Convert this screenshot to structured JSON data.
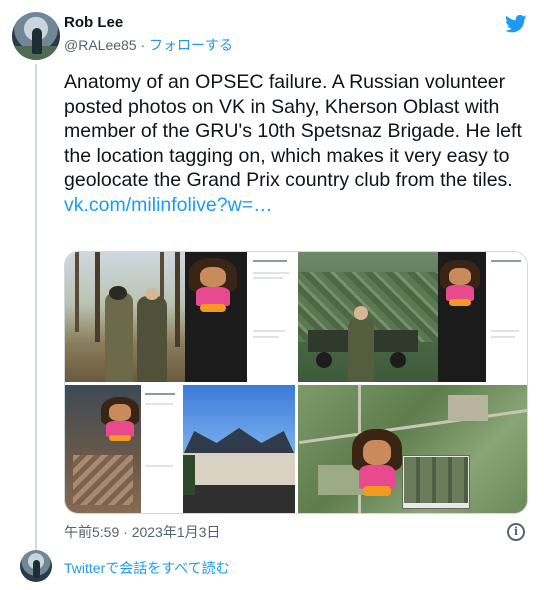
{
  "author": {
    "name": "Rob Lee",
    "handle": "@RALee85",
    "separator": "·",
    "follow_label": "フォローする"
  },
  "tweet": {
    "text": "Anatomy of an OPSEC failure. A Russian volunteer posted photos on VK in Sahy, Kherson Oblast with member of the GRU's 10th Spetsnaz Brigade. He left the location tagging on, which makes it very easy to geolocate the Grand Prix country club from the tiles.",
    "link_text": "vk.com/milinfolive?w=…"
  },
  "meta": {
    "timestamp": "午前5:59 · 2023年1月3日"
  },
  "footer": {
    "read_all_label": "Twitterで会話をすべて読む"
  },
  "colors": {
    "accent": "#1d9bf0",
    "secondary_text": "#536471",
    "border": "#cfd9de"
  },
  "icons": {
    "brand": "twitter-bird-icon",
    "info": "info-icon"
  }
}
